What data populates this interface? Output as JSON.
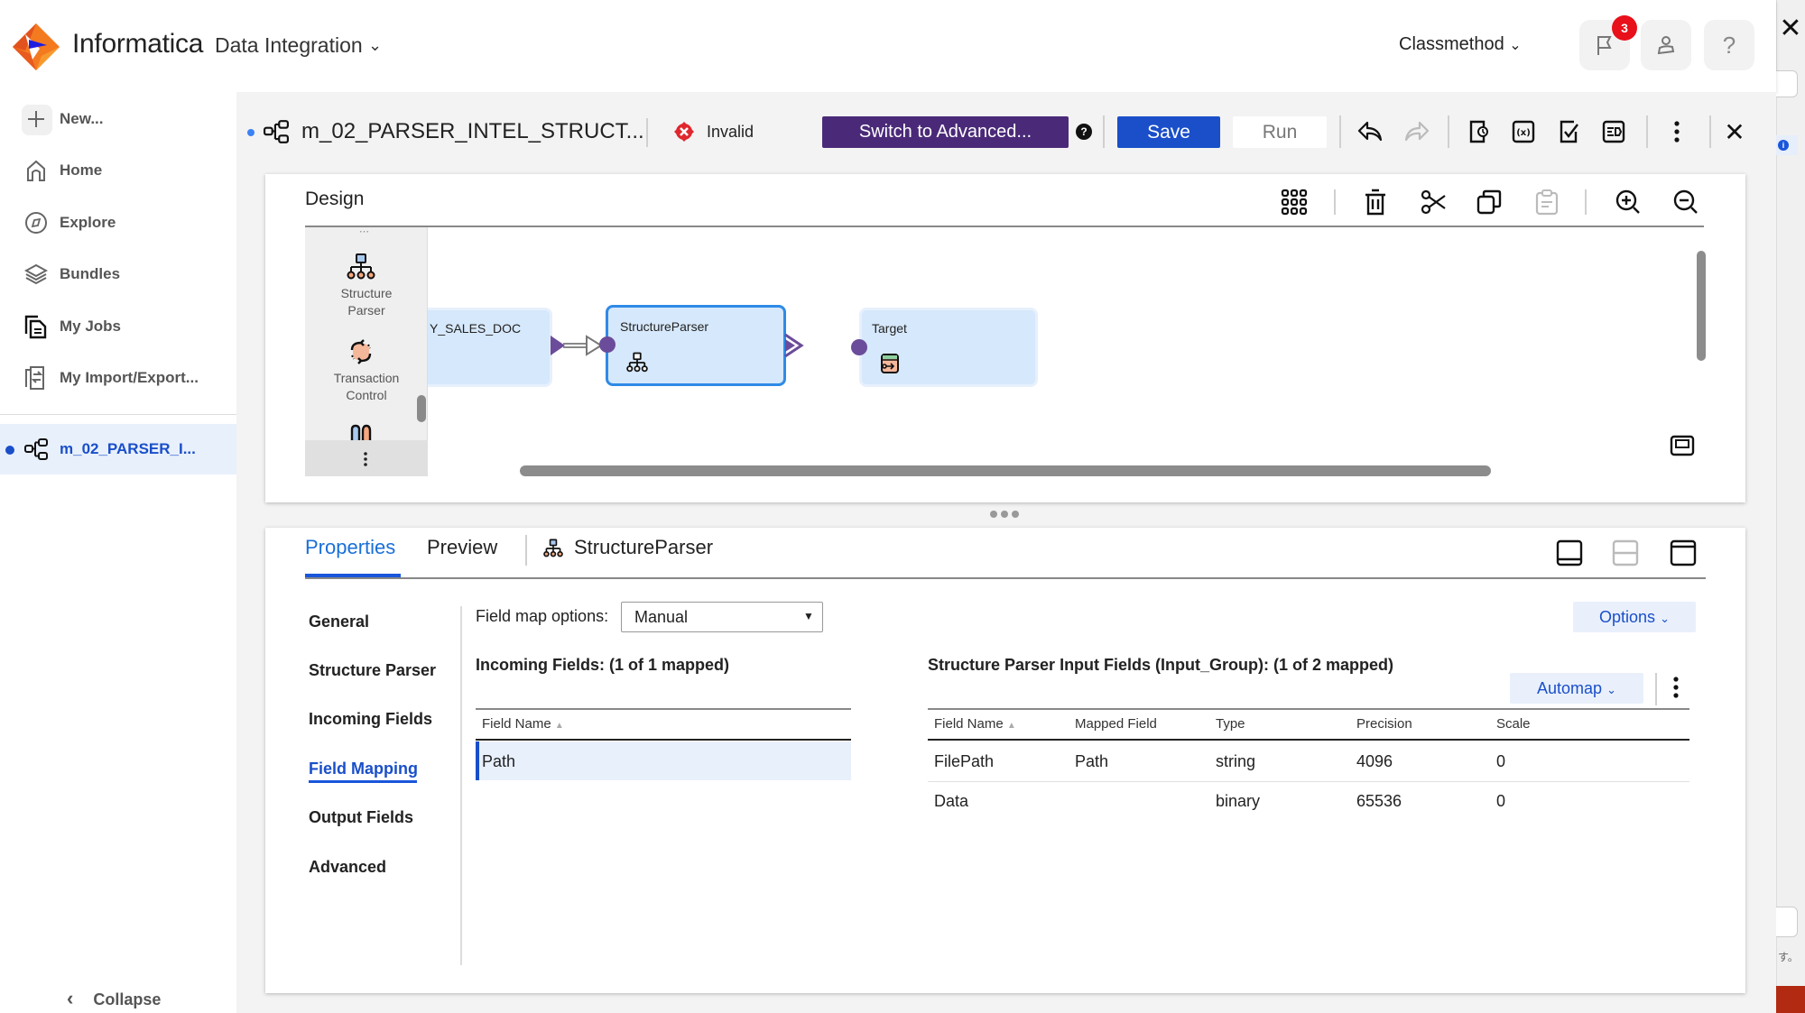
{
  "header": {
    "brand": "Informatica",
    "product": "Data Integration",
    "org": "Classmethod",
    "notifications_count": "3",
    "help_label": "?"
  },
  "sidebar": {
    "items": [
      {
        "label": "New...",
        "icon": "plus-icon"
      },
      {
        "label": "Home",
        "icon": "home-icon"
      },
      {
        "label": "Explore",
        "icon": "compass-icon"
      },
      {
        "label": "Bundles",
        "icon": "layers-icon"
      },
      {
        "label": "My Jobs",
        "icon": "jobs-icon"
      },
      {
        "label": "My Import/Export...",
        "icon": "import-export-icon"
      }
    ],
    "open_tab": "m_02_PARSER_I...",
    "collapse_label": "Collapse"
  },
  "toolbar": {
    "mapping_name": "m_02_PARSER_INTEL_STRUCT...",
    "status": "Invalid",
    "switch_label": "Switch to Advanced...",
    "help_glyph": "?",
    "save_label": "Save",
    "run_label": "Run"
  },
  "design": {
    "title": "Design",
    "palette": [
      {
        "label_line1": "Structure",
        "label_line2": "Parser"
      },
      {
        "label_line1": "Transaction",
        "label_line2": "Control"
      }
    ],
    "nodes": [
      {
        "name": "Y_SALES_DOC"
      },
      {
        "name": "StructureParser"
      },
      {
        "name": "Target"
      }
    ]
  },
  "properties": {
    "tabs": [
      "Properties",
      "Preview"
    ],
    "selected_object": "StructureParser",
    "menu": [
      "General",
      "Structure Parser",
      "Incoming Fields",
      "Field Mapping",
      "Output Fields",
      "Advanced"
    ],
    "active_menu": "Field Mapping",
    "field_map_label": "Field map options:",
    "field_map_value": "Manual",
    "options_label": "Options",
    "incoming_title": "Incoming Fields: (1 of 1 mapped)",
    "incoming_header": "Field Name",
    "incoming_rows": [
      "Path"
    ],
    "input_title": "Structure Parser Input Fields (Input_Group): (1 of 2 mapped)",
    "automap_label": "Automap",
    "input_headers": [
      "Field Name",
      "Mapped Field",
      "Type",
      "Precision",
      "Scale"
    ],
    "input_rows": [
      [
        "FilePath",
        "Path",
        "string",
        "4096",
        "0"
      ],
      [
        "Data",
        "",
        "binary",
        "65536",
        "0"
      ]
    ]
  },
  "background": {
    "fragment_text": "す。"
  },
  "colors": {
    "primary": "#1a4fc9",
    "switch": "#4a2a78",
    "port": "#6b4c9a",
    "node_fill": "#d6e8fb",
    "badge": "#e8101a"
  }
}
